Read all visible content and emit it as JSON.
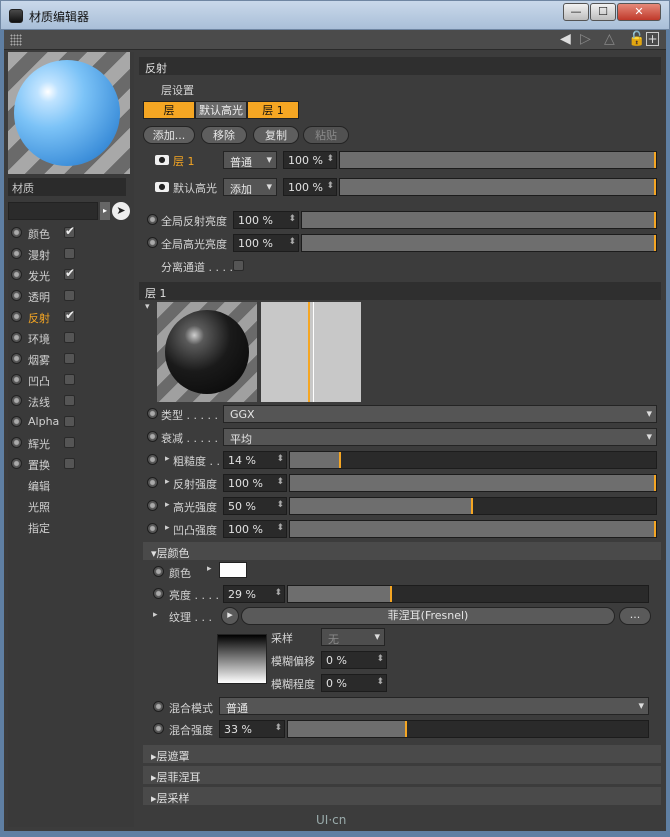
{
  "window": {
    "title": "材质编辑器",
    "min_label": "—",
    "max_label": "☐",
    "close_label": "✕"
  },
  "left": {
    "material_label": "材质",
    "channels": [
      {
        "name": "颜色",
        "checked": true,
        "radio": true
      },
      {
        "name": "漫射",
        "checked": false,
        "radio": true
      },
      {
        "name": "发光",
        "checked": true,
        "radio": true
      },
      {
        "name": "透明",
        "checked": false,
        "radio": true
      },
      {
        "name": "反射",
        "checked": true,
        "radio": true,
        "active": true
      },
      {
        "name": "环境",
        "checked": false,
        "radio": true
      },
      {
        "name": "烟雾",
        "checked": false,
        "radio": true
      },
      {
        "name": "凹凸",
        "checked": false,
        "radio": true
      },
      {
        "name": "法线",
        "checked": false,
        "radio": true
      },
      {
        "name": "Alpha",
        "checked": false,
        "radio": true
      },
      {
        "name": "辉光",
        "checked": false,
        "radio": true
      },
      {
        "name": "置换",
        "checked": false,
        "radio": true
      },
      {
        "name": "编辑",
        "checked": false,
        "radio": false
      },
      {
        "name": "光照",
        "checked": false,
        "radio": false
      },
      {
        "name": "指定",
        "checked": false,
        "radio": false
      }
    ]
  },
  "reflection": {
    "header": "反射",
    "layer_settings": "层设置",
    "layer_buttons": [
      "层",
      "默认高光",
      "层 1"
    ],
    "actions": {
      "add": "添加...",
      "remove": "移除",
      "copy": "复制",
      "paste": "粘贴"
    },
    "layers": [
      {
        "name": "层 1",
        "mode": "普通",
        "value": "100 %",
        "fill": 1.0
      },
      {
        "name": "默认高光",
        "mode": "添加",
        "value": "100 %",
        "fill": 1.0
      }
    ],
    "global_reflect": {
      "label": "全局反射亮度",
      "value": "100 %",
      "fill": 1.0
    },
    "global_spec": {
      "label": "全局高光亮度",
      "value": "100 %",
      "fill": 1.0
    },
    "separate_pass": "分离通道 . . . ."
  },
  "layer1": {
    "header": "层 1",
    "type_label": "类型 . . . . .",
    "type_value": "GGX",
    "atten_label": "衰减 . . . . .",
    "atten_value": "平均",
    "roughness": {
      "label": "粗糙度 . .",
      "value": "14 %",
      "fill": 0.14
    },
    "reflect_strength": {
      "label": "反射强度",
      "value": "100 %",
      "fill": 1.0
    },
    "spec_strength": {
      "label": "高光强度",
      "value": "50 %",
      "fill": 0.5
    },
    "bump_strength": {
      "label": "凹凸强度",
      "value": "100 %",
      "fill": 1.0
    }
  },
  "layer_color": {
    "header": "层颜色",
    "color_label": "颜色",
    "brightness": {
      "label": "亮度 . . . .",
      "value": "29 %",
      "fill": 0.29
    },
    "texture_label": "纹理 . . .",
    "texture_value": "菲涅耳(Fresnel)",
    "ellipsis": "...",
    "sampling_label": "采样",
    "sampling_value": "无",
    "blur_offset_label": "模糊偏移",
    "blur_offset_value": "0 %",
    "blur_scale_label": "模糊程度",
    "blur_scale_value": "0 %",
    "blend_mode_label": "混合模式",
    "blend_mode_value": "普通",
    "blend_strength": {
      "label": "混合强度",
      "value": "33 %",
      "fill": 0.33
    }
  },
  "collapsed_sections": [
    "层遮罩",
    "层菲涅耳",
    "层采样"
  ],
  "watermark": "UI·cn"
}
